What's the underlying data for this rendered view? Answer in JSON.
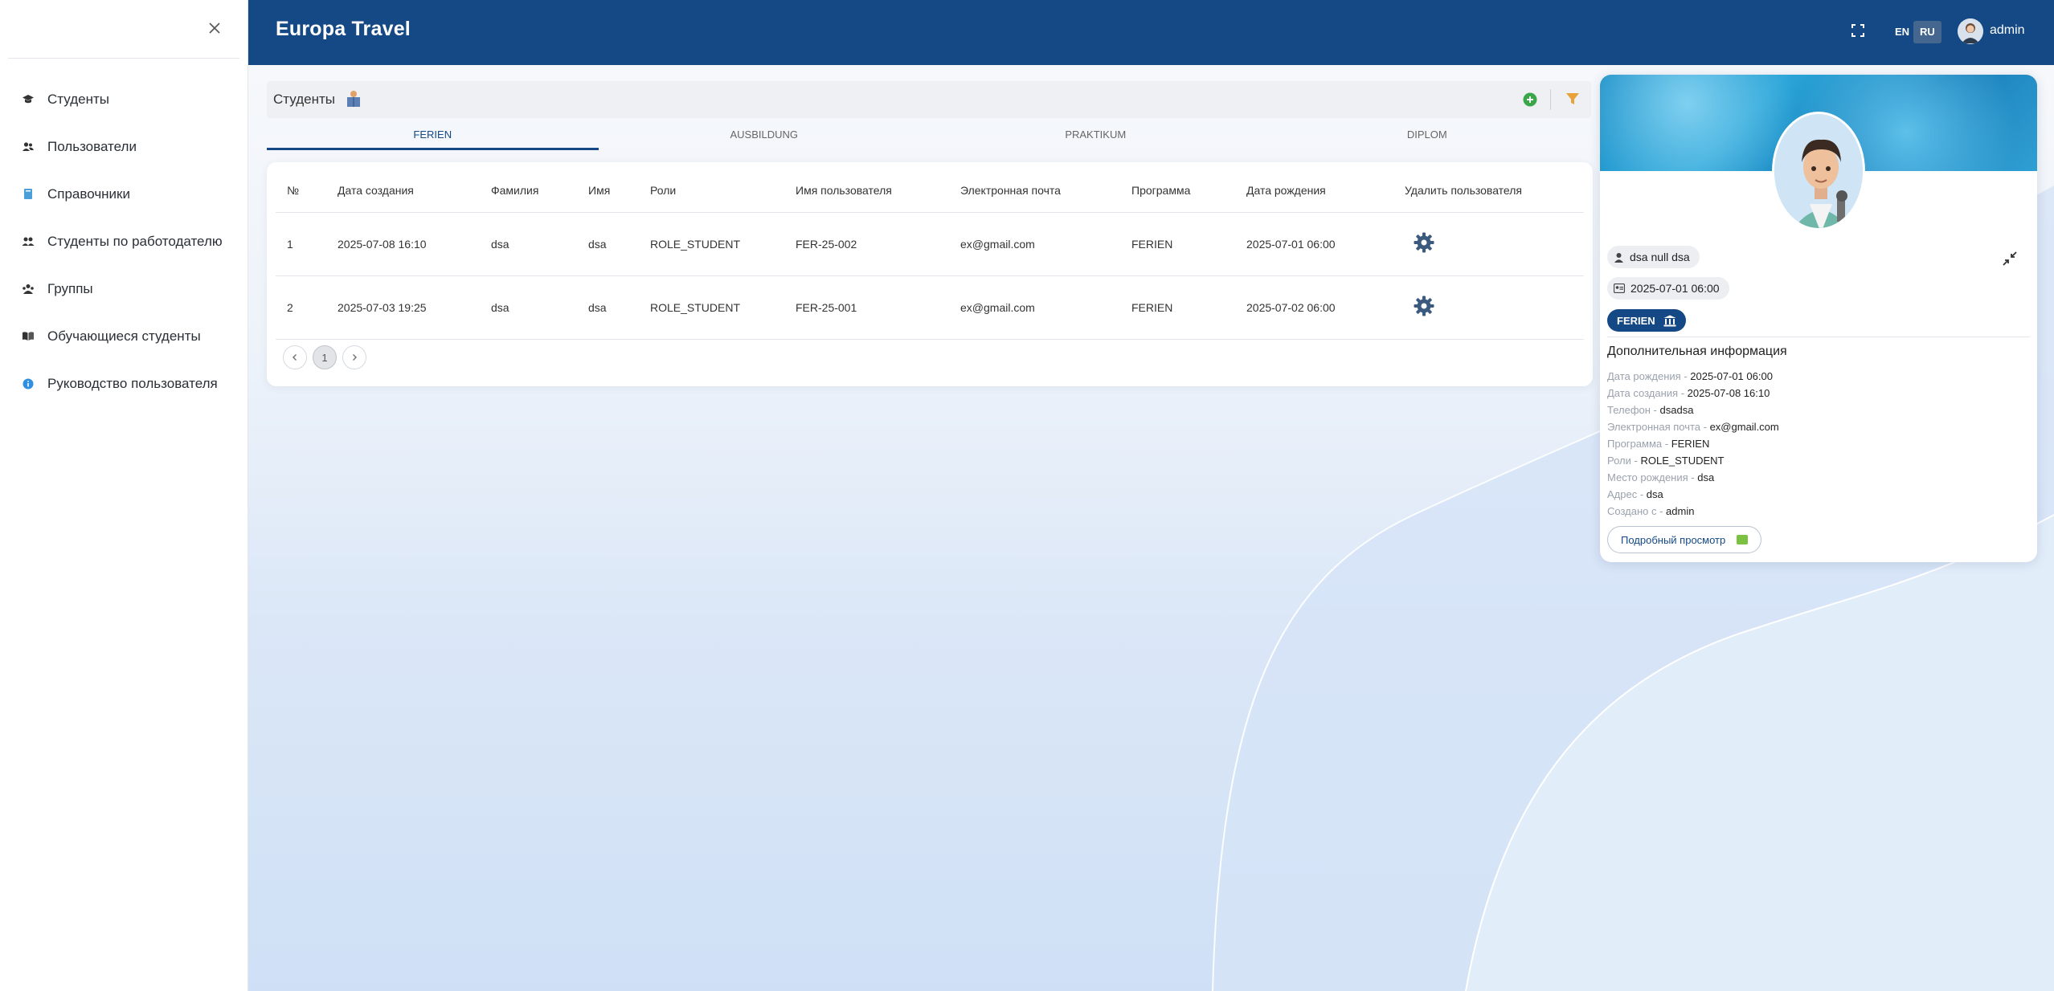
{
  "header": {
    "brand": "Europa Travel",
    "lang_en": "EN",
    "lang_ru": "RU",
    "username": "admin"
  },
  "sidebar": {
    "items": [
      {
        "label": "Студенты",
        "icon": "graduation-cap-icon"
      },
      {
        "label": "Пользователи",
        "icon": "users-icon"
      },
      {
        "label": "Справочники",
        "icon": "book-icon"
      },
      {
        "label": "Студенты по работодателю",
        "icon": "user-group-icon"
      },
      {
        "label": "Группы",
        "icon": "group-icon"
      },
      {
        "label": "Обучающиеся студенты",
        "icon": "open-book-icon"
      },
      {
        "label": "Руководство пользователя",
        "icon": "info-icon"
      }
    ]
  },
  "toolbar": {
    "title": "Студенты"
  },
  "tabs": [
    "FERIEN",
    "AUSBILDUNG",
    "PRAKTIKUM",
    "DIPLOM"
  ],
  "table": {
    "columns": [
      "№",
      "Дата создания",
      "Фамилия",
      "Имя",
      "Роли",
      "Имя пользователя",
      "Электронная почта",
      "Программа",
      "Дата рождения",
      "Удалить пользователя"
    ],
    "rows": [
      [
        "1",
        "2025-07-08 16:10",
        "dsa",
        "dsa",
        "ROLE_STUDENT",
        "FER-25-002",
        "ex@gmail.com",
        "FERIEN",
        "2025-07-01 06:00"
      ],
      [
        "2",
        "2025-07-03 19:25",
        "dsa",
        "dsa",
        "ROLE_STUDENT",
        "FER-25-001",
        "ex@gmail.com",
        "FERIEN",
        "2025-07-02 06:00"
      ]
    ]
  },
  "pagination": {
    "current": "1"
  },
  "profile": {
    "name": "dsa null dsa",
    "date": "2025-07-01 06:00",
    "program": "FERIEN",
    "info_title": "Дополнительная информация",
    "info": [
      {
        "key": "Дата рождения",
        "sep": " - ",
        "value": "2025-07-01 06:00"
      },
      {
        "key": "Дата создания",
        "sep": " - ",
        "value": "2025-07-08 16:10"
      },
      {
        "key": "Телефон",
        "sep": " - ",
        "value": "dsadsa"
      },
      {
        "key": "Электронная почта",
        "sep": " - ",
        "value": "ex@gmail.com"
      },
      {
        "key": "Программа",
        "sep": " - ",
        "value": "FERIEN"
      },
      {
        "key": "Роли",
        "sep": " - ",
        "value": "ROLE_STUDENT"
      },
      {
        "key": "Место рождения",
        "sep": " - ",
        "value": "dsa"
      },
      {
        "key": "Адрес",
        "sep": " - ",
        "value": "dsa"
      },
      {
        "key": "Создано с",
        "sep": " - ",
        "value": "admin"
      }
    ],
    "detail_button": "Подробный просмотр"
  },
  "colors": {
    "header_bg": "#144985",
    "accent": "#144985",
    "add_green": "#3aa64a",
    "filter_orange": "#e8a23a"
  }
}
